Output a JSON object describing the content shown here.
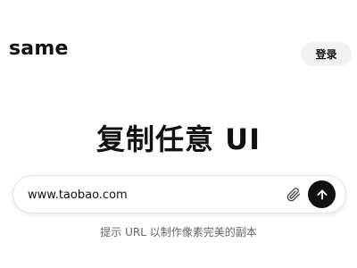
{
  "header": {
    "logo": "same",
    "login_label": "登录"
  },
  "hero": {
    "title": "复制任意 UI"
  },
  "prompt": {
    "value": "www.taobao.com",
    "attach_icon": "paperclip-icon",
    "submit_icon": "arrow-up-icon"
  },
  "hint": "提示 URL 以制作像素完美的副本",
  "colors": {
    "background": "#ffffff",
    "text": "#111111",
    "login_button_bg": "#f2f2f2",
    "submit_button_bg": "#111111",
    "hint_text": "#666666"
  }
}
